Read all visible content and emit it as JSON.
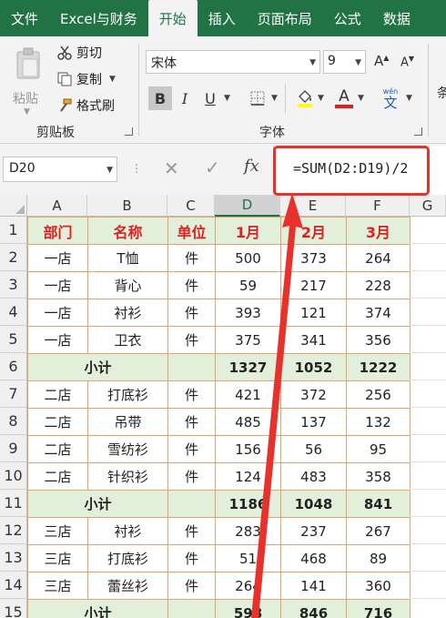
{
  "ribbon_tabs": [
    "文件",
    "Excel与财务",
    "开始",
    "插入",
    "页面布局",
    "公式",
    "数据"
  ],
  "active_tab": "开始",
  "clipboard": {
    "paste_label": "粘贴",
    "cut_label": "剪切",
    "copy_label": "复制",
    "format_painter_label": "格式刷",
    "group_label": "剪贴板"
  },
  "font": {
    "font_name": "宋体",
    "font_size": "9",
    "grow_label": "A",
    "shrink_label": "A",
    "bold_label": "B",
    "italic_label": "I",
    "underline_label": "U",
    "font_color_label": "A",
    "phonetic_label": "文",
    "phonetic_top": "wén",
    "group_label": "字体"
  },
  "next_group_glyph": "条",
  "formula_bar": {
    "name_box": "D20",
    "cancel_glyph": "✕",
    "enter_glyph": "✓",
    "fx_label": "fx",
    "formula": "=SUM(D2:D19)/2"
  },
  "column_headers": [
    "A",
    "B",
    "C",
    "D",
    "E",
    "F",
    "G"
  ],
  "selected_column": "D",
  "row_numbers": [
    "1",
    "2",
    "3",
    "4",
    "5",
    "6",
    "7",
    "8",
    "9",
    "10",
    "11",
    "12",
    "13",
    "14",
    "15"
  ],
  "rows": [
    {
      "type": "hdr",
      "cells": [
        "部门",
        "名称",
        "单位",
        "1月",
        "2月",
        "3月"
      ]
    },
    {
      "type": "data",
      "cells": [
        "一店",
        "T恤",
        "件",
        "500",
        "373",
        "264"
      ]
    },
    {
      "type": "data",
      "cells": [
        "一店",
        "背心",
        "件",
        "59",
        "217",
        "228"
      ]
    },
    {
      "type": "data",
      "cells": [
        "一店",
        "衬衫",
        "件",
        "393",
        "121",
        "374"
      ]
    },
    {
      "type": "data",
      "cells": [
        "一店",
        "卫衣",
        "件",
        "375",
        "341",
        "356"
      ]
    },
    {
      "type": "sub",
      "label": "小计",
      "cells": [
        "1327",
        "1052",
        "1222"
      ]
    },
    {
      "type": "data",
      "cells": [
        "二店",
        "打底衫",
        "件",
        "421",
        "372",
        "256"
      ]
    },
    {
      "type": "data",
      "cells": [
        "二店",
        "吊带",
        "件",
        "485",
        "137",
        "132"
      ]
    },
    {
      "type": "data",
      "cells": [
        "二店",
        "雪纺衫",
        "件",
        "156",
        "56",
        "95"
      ]
    },
    {
      "type": "data",
      "cells": [
        "二店",
        "针织衫",
        "件",
        "124",
        "483",
        "358"
      ]
    },
    {
      "type": "sub",
      "label": "小计",
      "cells": [
        "1186",
        "1048",
        "841"
      ]
    },
    {
      "type": "data",
      "cells": [
        "三店",
        "衬衫",
        "件",
        "283",
        "237",
        "267"
      ]
    },
    {
      "type": "data",
      "cells": [
        "三店",
        "打底衫",
        "件",
        "51",
        "468",
        "89"
      ]
    },
    {
      "type": "data",
      "cells": [
        "三店",
        "蕾丝衫",
        "件",
        "264",
        "141",
        "360"
      ]
    },
    {
      "type": "sub",
      "label": "小计",
      "cells": [
        "598",
        "846",
        "716"
      ]
    }
  ],
  "colors": {
    "excel_green": "#217346",
    "header_text": "#e02020",
    "row_fill": "#e2efda",
    "cell_border": "#e3a36c",
    "annotation_red": "#e8312a"
  }
}
